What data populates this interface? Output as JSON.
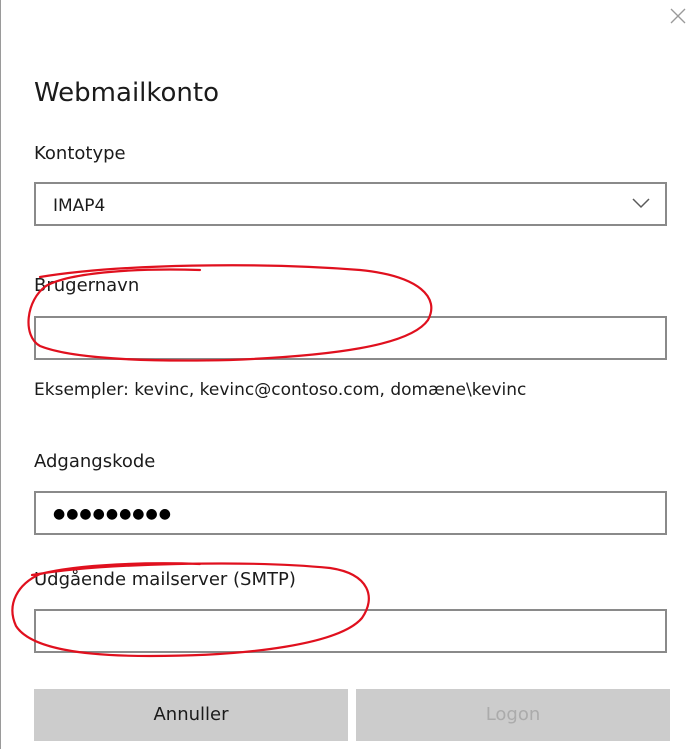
{
  "dialog": {
    "title": "Webmailkonto",
    "close_icon": "close-icon"
  },
  "account_type": {
    "label": "Kontotype",
    "value": "IMAP4",
    "icon": "chevron-down-icon"
  },
  "username": {
    "label": "Brugernavn",
    "value": "",
    "hint": "Eksempler: kevinc, kevinc@contoso.com, domæne\\kevinc"
  },
  "password": {
    "label": "Adgangskode",
    "masked_value": "●●●●●●●●●"
  },
  "smtp": {
    "label": "Udgående mailserver (SMTP)",
    "value": ""
  },
  "buttons": {
    "cancel": "Annuller",
    "logon": "Logon"
  },
  "colors": {
    "field_border": "#8a8a8a",
    "button_bg": "#cccccc",
    "disabled_text": "#ababab",
    "annotation": "#e0101e"
  }
}
